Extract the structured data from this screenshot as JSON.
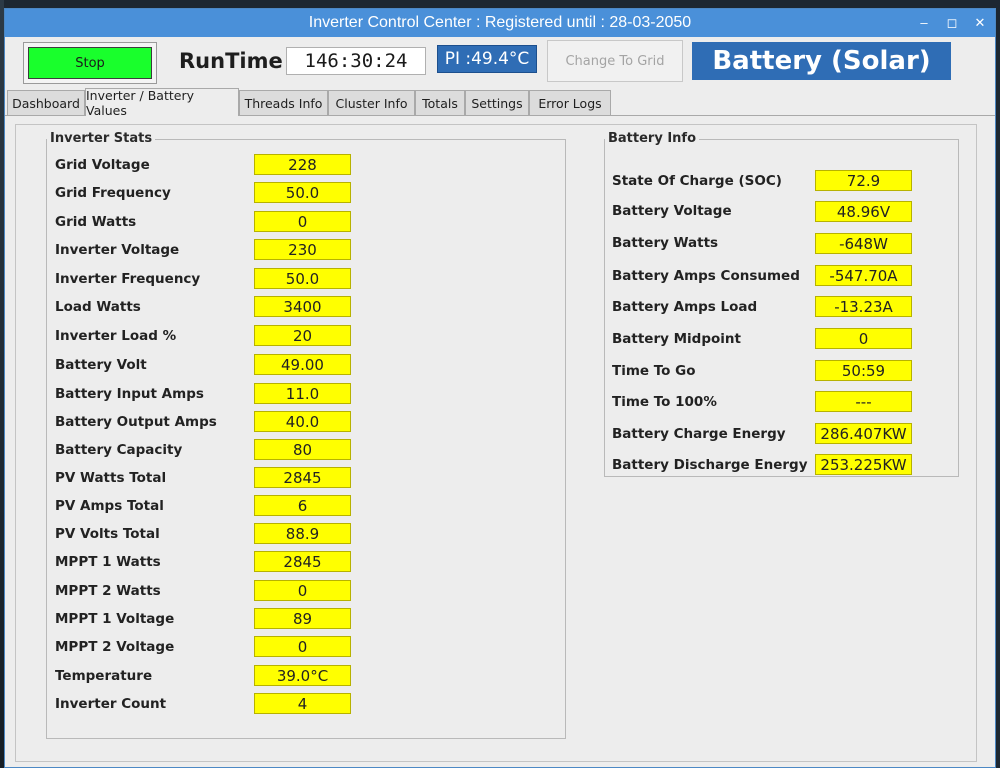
{
  "window": {
    "title": "Inverter Control Center : Registered until : 28-03-2050"
  },
  "window_controls": {
    "minimize": "–",
    "maximize": "◻",
    "close": "✕"
  },
  "header": {
    "stop_label": "Stop",
    "runtime_label": "RunTime",
    "runtime_value": "146:30:24",
    "pi_temp": "PI :49.4°C",
    "change_grid_label": "Change To Grid",
    "mode": "Battery (Solar)"
  },
  "tabs": [
    {
      "label": "Dashboard"
    },
    {
      "label": "Inverter / Battery Values"
    },
    {
      "label": "Threads Info"
    },
    {
      "label": "Cluster Info"
    },
    {
      "label": "Totals"
    },
    {
      "label": "Settings"
    },
    {
      "label": "Error Logs"
    }
  ],
  "inverter_stats": {
    "title": "Inverter Stats",
    "rows": [
      {
        "label": "Grid Voltage",
        "value": "228"
      },
      {
        "label": "Grid Frequency",
        "value": "50.0"
      },
      {
        "label": "Grid Watts",
        "value": "0"
      },
      {
        "label": "Inverter Voltage",
        "value": "230"
      },
      {
        "label": "Inverter Frequency",
        "value": "50.0"
      },
      {
        "label": "Load Watts",
        "value": "3400"
      },
      {
        "label": "Inverter Load %",
        "value": "20"
      },
      {
        "label": "Battery Volt",
        "value": "49.00"
      },
      {
        "label": "Battery Input Amps",
        "value": "11.0"
      },
      {
        "label": "Battery Output Amps",
        "value": "40.0"
      },
      {
        "label": "Battery Capacity",
        "value": "80"
      },
      {
        "label": "PV Watts Total",
        "value": "2845"
      },
      {
        "label": "PV Amps Total",
        "value": "6"
      },
      {
        "label": "PV Volts Total",
        "value": "88.9"
      },
      {
        "label": "MPPT 1 Watts",
        "value": "2845"
      },
      {
        "label": "MPPT 2 Watts",
        "value": "0"
      },
      {
        "label": "MPPT 1 Voltage",
        "value": "89"
      },
      {
        "label": "MPPT 2 Voltage",
        "value": "0"
      },
      {
        "label": "Temperature",
        "value": "39.0°C"
      },
      {
        "label": "Inverter Count",
        "value": "4"
      }
    ]
  },
  "battery_info": {
    "title": "Battery Info",
    "rows": [
      {
        "label": "State Of Charge (SOC)",
        "value": "72.9"
      },
      {
        "label": "Battery Voltage",
        "value": "48.96V"
      },
      {
        "label": "Battery Watts",
        "value": "-648W"
      },
      {
        "label": "Battery Amps Consumed",
        "value": "-547.70A"
      },
      {
        "label": "Battery Amps Load",
        "value": "-13.23A"
      },
      {
        "label": "Battery Midpoint",
        "value": "0"
      },
      {
        "label": "Time To Go",
        "value": "50:59"
      },
      {
        "label": "Time To 100%",
        "value": "---"
      },
      {
        "label": "Battery Charge Energy",
        "value": "286.407KW"
      },
      {
        "label": "Battery Discharge Energy",
        "value": "253.225KW"
      }
    ]
  },
  "colors": {
    "title_bar": "#4a90d9",
    "stop_button": "#19ff2c",
    "accent_blue": "#2f6db5",
    "value_fill": "#ffff00"
  }
}
